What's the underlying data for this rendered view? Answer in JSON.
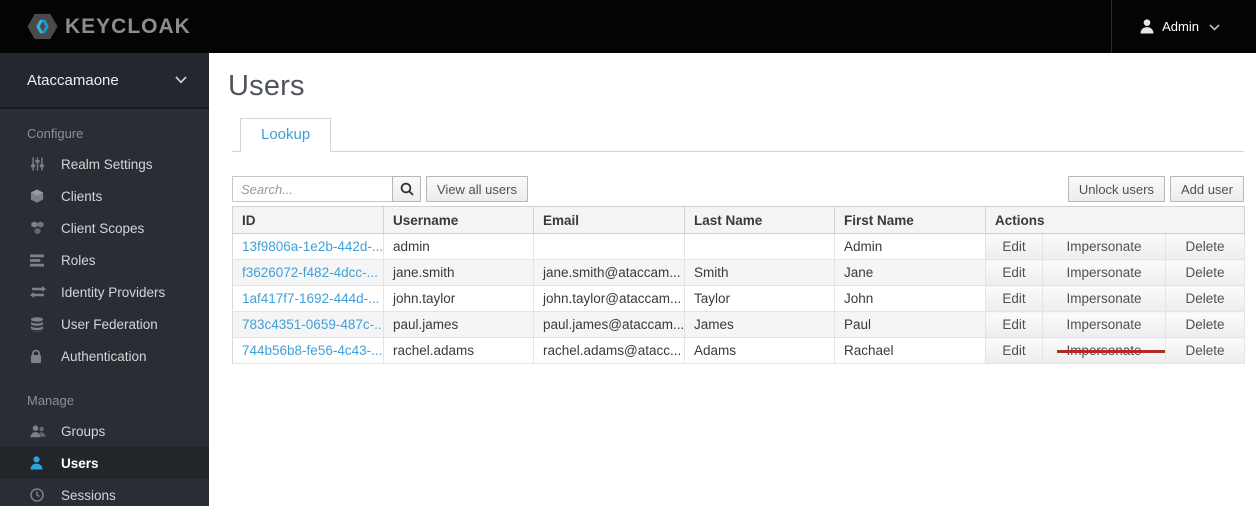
{
  "header": {
    "brand": "KEYCLOAK",
    "admin_label": "Admin"
  },
  "sidebar": {
    "realm_name": "Ataccamaone",
    "sections": [
      {
        "label": "Configure",
        "items": [
          {
            "label": "Realm Settings",
            "icon": "sliders-icon"
          },
          {
            "label": "Clients",
            "icon": "cube-icon"
          },
          {
            "label": "Client Scopes",
            "icon": "cubes-icon"
          },
          {
            "label": "Roles",
            "icon": "list-icon"
          },
          {
            "label": "Identity Providers",
            "icon": "exchange-arrows-icon"
          },
          {
            "label": "User Federation",
            "icon": "database-icon"
          },
          {
            "label": "Authentication",
            "icon": "lock-icon"
          }
        ]
      },
      {
        "label": "Manage",
        "items": [
          {
            "label": "Groups",
            "icon": "group-icon"
          },
          {
            "label": "Users",
            "icon": "user-icon",
            "active": true
          },
          {
            "label": "Sessions",
            "icon": "clock-icon"
          }
        ]
      }
    ]
  },
  "main": {
    "title": "Users",
    "tab_label": "Lookup",
    "toolbar": {
      "search_placeholder": "Search...",
      "view_all_label": "View all users",
      "unlock_label": "Unlock users",
      "add_label": "Add user"
    },
    "table": {
      "columns": {
        "id": "ID",
        "username": "Username",
        "email": "Email",
        "last_name": "Last Name",
        "first_name": "First Name",
        "actions": "Actions"
      },
      "action_labels": {
        "edit": "Edit",
        "impersonate": "Impersonate",
        "delete": "Delete"
      },
      "rows": [
        {
          "id": "13f9806a-1e2b-442d-...",
          "username": "admin",
          "email": "",
          "last_name": "",
          "first_name": "Admin"
        },
        {
          "id": "f3626072-f482-4dcc-...",
          "username": "jane.smith",
          "email": "jane.smith@ataccam...",
          "last_name": "Smith",
          "first_name": "Jane"
        },
        {
          "id": "1af417f7-1692-444d-...",
          "username": "john.taylor",
          "email": "john.taylor@ataccam...",
          "last_name": "Taylor",
          "first_name": "John"
        },
        {
          "id": "783c4351-0659-487c-...",
          "username": "paul.james",
          "email": "paul.james@ataccam...",
          "last_name": "James",
          "first_name": "Paul"
        },
        {
          "id": "744b56b8-fe56-4c43-...",
          "username": "rachel.adams",
          "email": "rachel.adams@atacc...",
          "last_name": "Adams",
          "first_name": "Rachael"
        }
      ]
    },
    "annotation": {
      "shape": "strikethrough-arrow",
      "color": "#b22a22",
      "row_username": "rachel.adams",
      "from_action": "Impersonate",
      "to_action": "Delete"
    }
  },
  "colors": {
    "topbar_bg": "#040404",
    "sidebar_bg": "#2a2e34",
    "accent_blue": "#2fa3dc",
    "link_blue": "#42a0d6",
    "tab_blue": "#3ba0d9",
    "annotation_red": "#b22a22"
  }
}
